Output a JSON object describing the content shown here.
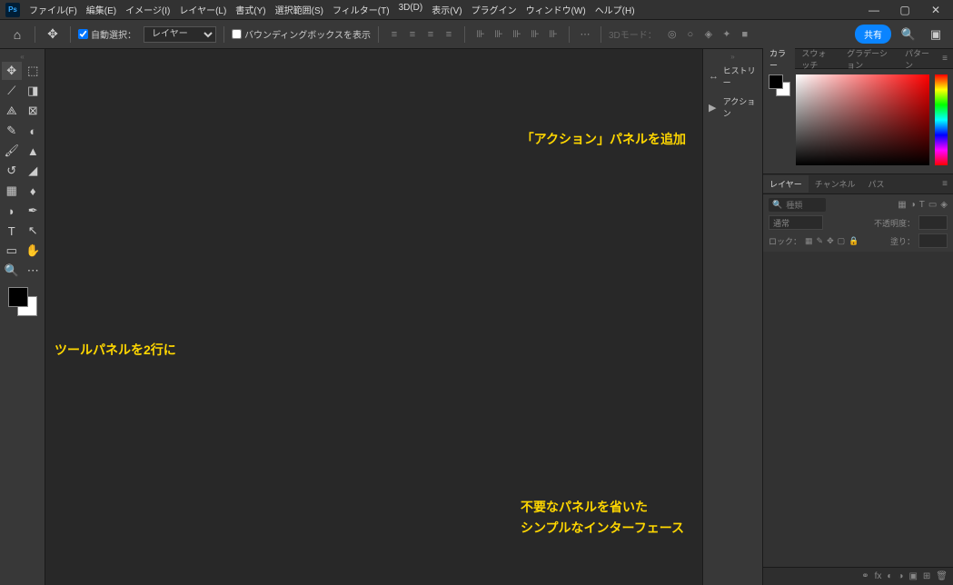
{
  "menu": [
    "ファイル(F)",
    "編集(E)",
    "イメージ(I)",
    "レイヤー(L)",
    "書式(Y)",
    "選択範囲(S)",
    "フィルター(T)",
    "3D(D)",
    "表示(V)",
    "プラグイン",
    "ウィンドウ(W)",
    "ヘルプ(H)"
  ],
  "options": {
    "auto_select_label": "自動選択：",
    "target": "レイヤー",
    "bbox_label": "バウンディングボックスを表示",
    "mode_3d_label": "3Dモード："
  },
  "share_label": "共有",
  "collapsed_tabs": [
    {
      "icon": "↔",
      "label": "ヒストリー"
    },
    {
      "icon": "▶",
      "label": "アクション"
    }
  ],
  "color_panel": {
    "tabs": [
      "カラー",
      "スウォッチ",
      "グラデーション",
      "パターン"
    ]
  },
  "layers_panel": {
    "tabs": [
      "レイヤー",
      "チャンネル",
      "パス"
    ],
    "search_placeholder": "種類",
    "blend_label": "通常",
    "opacity_label": "不透明度：",
    "lock_label": "ロック：",
    "fill_label": "塗り："
  },
  "annotations": {
    "a1": "「アクション」パネルを追加",
    "a2": "ツールパネルを2行に",
    "a3_l1": "不要なパネルを省いた",
    "a3_l2": "シンプルなインターフェース"
  }
}
